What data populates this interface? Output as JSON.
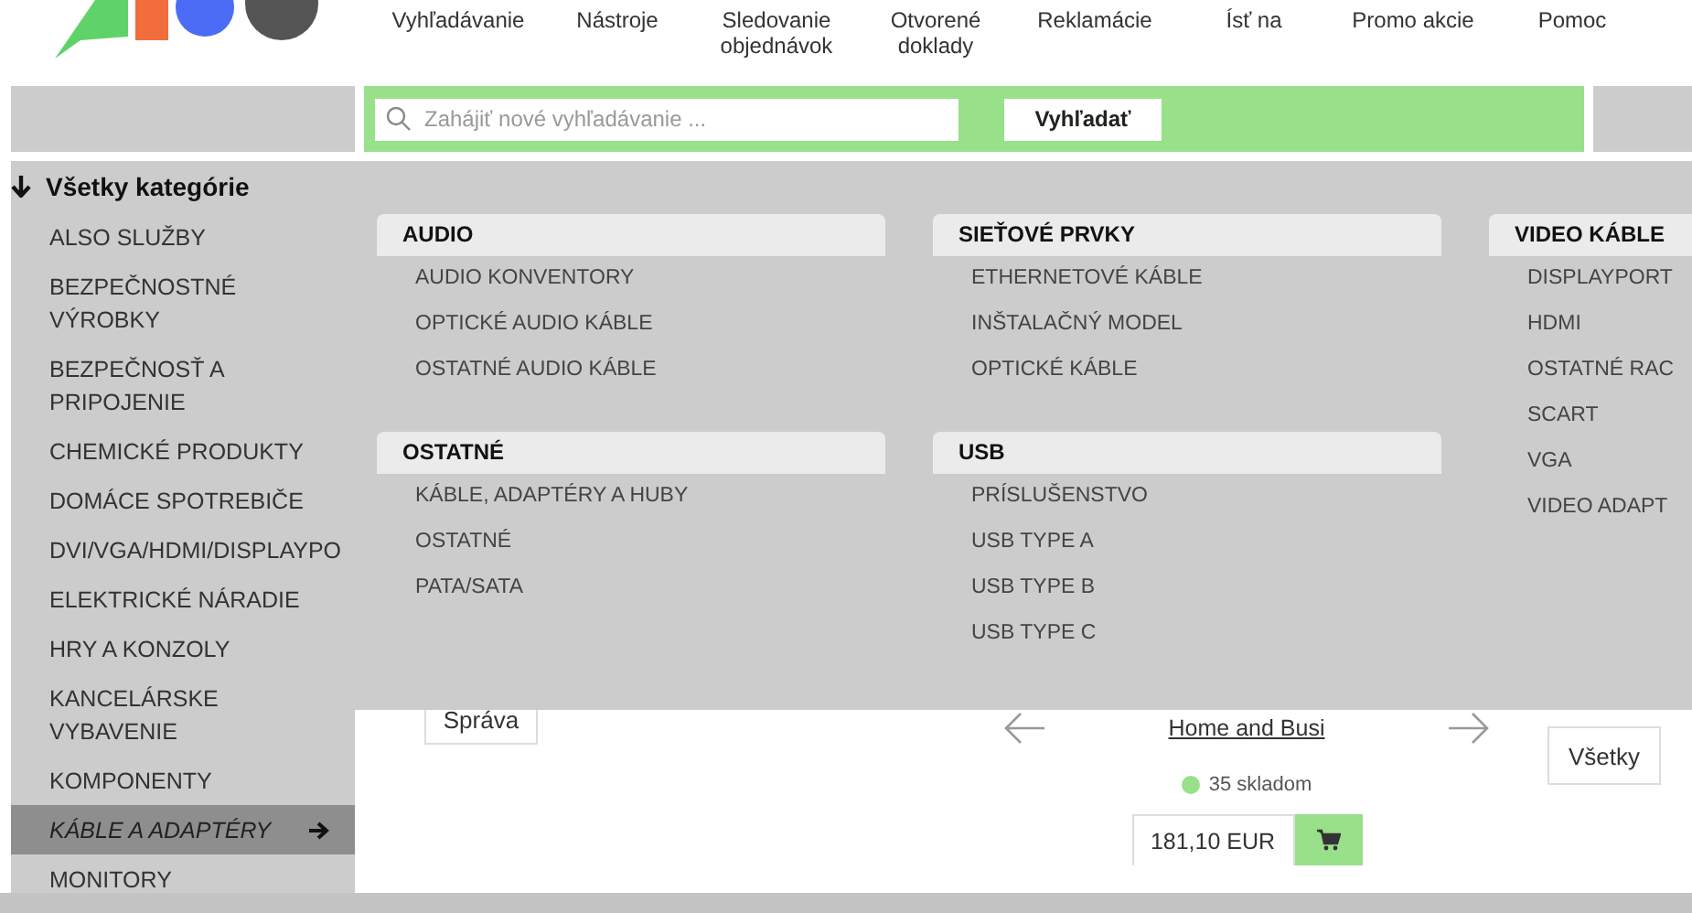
{
  "nav": [
    "Vyhľadávanie",
    "Nástroje",
    "Sledovanie objednávok",
    "Otvorené doklady",
    "Reklamácie",
    "Ísť na",
    "Promo akcie",
    "Pomoc"
  ],
  "search": {
    "placeholder": "Zahájiť nové vyhľadávanie ...",
    "button": "Vyhľadať"
  },
  "sidebar": {
    "title": "Všetky kategórie",
    "items": [
      {
        "label": "ALSO SLUŽBY",
        "selected": false
      },
      {
        "label": "BEZPEČNOSTNÉ VÝROBKY",
        "selected": false
      },
      {
        "label": "BEZPEČNOSŤ A PRIPOJENIE",
        "selected": false
      },
      {
        "label": "CHEMICKÉ PRODUKTY",
        "selected": false
      },
      {
        "label": "DOMÁCE SPOTREBIČE",
        "selected": false
      },
      {
        "label": "DVI/VGA/HDMI/DISPLAYPO",
        "selected": false
      },
      {
        "label": "ELEKTRICKÉ NÁRADIE",
        "selected": false
      },
      {
        "label": "HRY A KONZOLY",
        "selected": false
      },
      {
        "label": "KANCELÁRSKE VYBAVENIE",
        "selected": false
      },
      {
        "label": "KOMPONENTY",
        "selected": false
      },
      {
        "label": "KÁBLE A ADAPTÉRY",
        "selected": true
      },
      {
        "label": "MONITORY",
        "selected": false
      }
    ]
  },
  "mega_menu": {
    "columns": [
      {
        "groups": [
          {
            "title": "AUDIO",
            "items": [
              "AUDIO KONVENTORY",
              "OPTICKÉ AUDIO KÁBLE",
              "OSTATNÉ AUDIO KÁBLE"
            ]
          },
          {
            "title": "OSTATNÉ",
            "items": [
              "KÁBLE, ADAPTÉRY A HUBY",
              "OSTATNÉ",
              "PATA/SATA"
            ]
          }
        ]
      },
      {
        "groups": [
          {
            "title": "SIEŤOVÉ PRVKY",
            "items": [
              "ETHERNETOVÉ KÁBLE",
              "INŠTALAČNÝ MODEL",
              "OPTICKÉ KÁBLE"
            ]
          },
          {
            "title": "USB",
            "items": [
              "PRÍSLUŠENSTVO",
              "USB TYPE A",
              "USB TYPE B",
              "USB TYPE C"
            ]
          }
        ]
      },
      {
        "groups": [
          {
            "title": "VIDEO KÁBLE",
            "items": [
              "DISPLAYPORT",
              "HDMI",
              "OSTATNÉ RAC",
              "SCART",
              "VGA",
              "VIDEO ADAPT"
            ]
          }
        ]
      }
    ]
  },
  "content": {
    "news_button": "Správa",
    "product": {
      "title": "Home and Busi",
      "stock": "35 skladom",
      "price": "181,10 EUR"
    },
    "all_button": "Všetky"
  }
}
